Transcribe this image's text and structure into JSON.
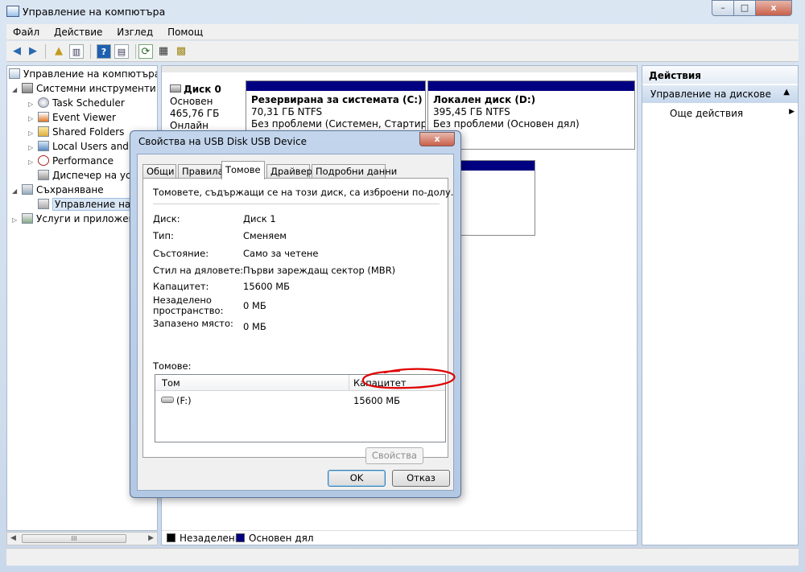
{
  "window": {
    "title": "Управление на компютъра",
    "min": "–",
    "max": "□",
    "close": "x"
  },
  "menu": [
    "Файл",
    "Действие",
    "Изглед",
    "Помощ"
  ],
  "toolbar": {
    "icons": [
      "back-arrow-icon",
      "forward-arrow-icon",
      "up-folder-icon",
      "show-hide-tree-icon",
      "help-icon",
      "show-hide-action-pane-icon",
      "refresh-icon",
      "properties-icon",
      "export-icon"
    ]
  },
  "tree": {
    "root": "Управление на компютъра (л",
    "system_tools": "Системни инструменти",
    "task_scheduler": "Task Scheduler",
    "event_viewer": "Event Viewer",
    "shared_folders": "Shared Folders",
    "local_users": "Local Users and G",
    "performance": "Performance",
    "device_manager": "Диспечер на уст",
    "storage": "Съхраняване",
    "disk_management": "Управление на д",
    "services": "Услуги и приложен",
    "scroll_grip": "III"
  },
  "disks": {
    "disk0": {
      "name": "Диск 0",
      "type": "Основен",
      "size": "465,76 ГБ",
      "status": "Онлайн"
    },
    "partitions": [
      {
        "name": "Резервирана за системата  (C:)",
        "size": "70,31 ГБ NTFS",
        "status": "Без проблеми (Системен, Стартиране"
      },
      {
        "name": "Локален диск  (D:)",
        "size": "395,45 ГБ NTFS",
        "status": "Без проблеми (Основен дял)"
      }
    ]
  },
  "legend": {
    "unallocated": "Незаделени",
    "primary": "Основен дял",
    "unallocated_color": "#000000",
    "primary_color": "#000080"
  },
  "actions": {
    "header": "Действия",
    "group": "Управление на дискове",
    "more": "Още действия"
  },
  "dialog": {
    "title": "Свойства на USB Disk USB Device",
    "close": "x",
    "tabs": [
      "Общи",
      "Правила",
      "Томове",
      "Драйвер",
      "Подробни данни"
    ],
    "active_tab": "Томове",
    "intro": "Томовете, съдържащи се на този диск, са изброени по-долу.",
    "props": [
      {
        "label": "Диск:",
        "value": "Диск 1"
      },
      {
        "label": "Тип:",
        "value": "Сменяем"
      },
      {
        "label": "Състояние:",
        "value": "Само за четене"
      },
      {
        "label": "Стил на дяловете:",
        "value": "Първи зареждащ сектор (MBR)"
      },
      {
        "label": "Капацитет:",
        "value": "15600 МБ"
      },
      {
        "label": "Незаделено пространство:",
        "value": "0 МБ"
      },
      {
        "label": "Запазено място:",
        "value": "0 МБ"
      }
    ],
    "unalloc_line1": "Незаделено",
    "unalloc_line2": "пространство:",
    "volumes_label": "Томове:",
    "columns": {
      "volume": "Том",
      "capacity": "Капацитет"
    },
    "volumes": [
      {
        "name": "(F:)",
        "capacity": "15600 МБ"
      }
    ],
    "properties_button": "Свойства",
    "ok": "OK",
    "cancel": "Отказ",
    "annotation_color": "#e00000"
  }
}
